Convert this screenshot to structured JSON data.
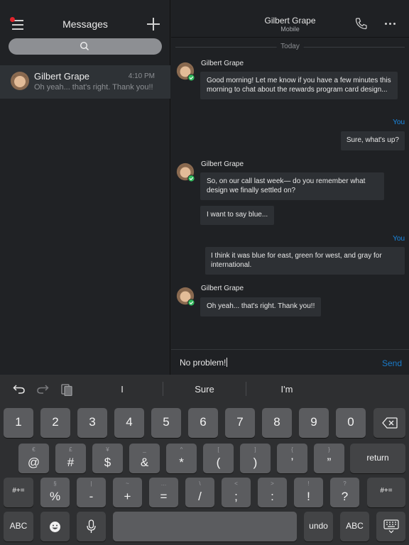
{
  "left_pane": {
    "title": "Messages",
    "conversations": [
      {
        "name": "Gilbert Grape",
        "time": "4:10 PM",
        "preview": "Oh yeah... that's right. Thank you!!"
      }
    ]
  },
  "chat": {
    "contact_name": "Gilbert Grape",
    "contact_type": "Mobile",
    "day_separator": "Today",
    "you_label": "You",
    "messages": [
      {
        "sender": "Gilbert Grape",
        "text": "Good morning! Let me know if you have a few minutes this morning to chat about the rewards program card design..."
      },
      {
        "sender": "You",
        "text": "Sure, what's up?"
      },
      {
        "sender": "Gilbert Grape",
        "text": "So, on our call last week— do you remember what design we finally settled on?"
      },
      {
        "sender": "Gilbert Grape",
        "text": "I want to say blue..."
      },
      {
        "sender": "You",
        "text": "I think it was blue for east, green for west, and gray for international."
      },
      {
        "sender": "Gilbert Grape",
        "text": "Oh yeah... that's right. Thank you!!"
      }
    ]
  },
  "composer": {
    "value": "No problem!",
    "send_label": "Send"
  },
  "keyboard": {
    "suggestions": [
      "I",
      "Sure",
      "I'm"
    ],
    "number_row": [
      "1",
      "2",
      "3",
      "4",
      "5",
      "6",
      "7",
      "8",
      "9",
      "0"
    ],
    "symbol_row": [
      {
        "main": "@",
        "sub": "€"
      },
      {
        "main": "#",
        "sub": "£"
      },
      {
        "main": "$",
        "sub": "¥"
      },
      {
        "main": "&",
        "sub": "_"
      },
      {
        "main": "*",
        "sub": "^"
      },
      {
        "main": "(",
        "sub": "["
      },
      {
        "main": ")",
        "sub": "]"
      },
      {
        "main": "’",
        "sub": "{"
      },
      {
        "main": "”",
        "sub": "}"
      }
    ],
    "punct_row": [
      {
        "main": "%",
        "sub": "§"
      },
      {
        "main": "-",
        "sub": "|"
      },
      {
        "main": "+",
        "sub": "~"
      },
      {
        "main": "=",
        "sub": "…"
      },
      {
        "main": "/",
        "sub": "\\"
      },
      {
        "main": ";",
        "sub": "<"
      },
      {
        "main": ":",
        "sub": ">"
      },
      {
        "main": "!",
        "sub": "!"
      },
      {
        "main": "?",
        "sub": "?"
      }
    ],
    "return_label": "return",
    "shift_label": "#+=",
    "abc_label": "ABC",
    "undo_label": "undo"
  },
  "icons": {
    "menu": "menu-icon",
    "compose": "plus-icon",
    "search": "search-icon",
    "call": "phone-icon",
    "more": "ellipsis-icon",
    "undo": "undo-icon",
    "redo": "redo-icon",
    "paste": "clipboard-icon",
    "delete": "backspace-icon",
    "emoji": "emoji-icon",
    "mic": "microphone-icon",
    "dismiss": "keyboard-dismiss-icon"
  },
  "colors": {
    "accent": "#1a8ae6",
    "notification": "#e0242c",
    "presence": "#2fb85a"
  }
}
